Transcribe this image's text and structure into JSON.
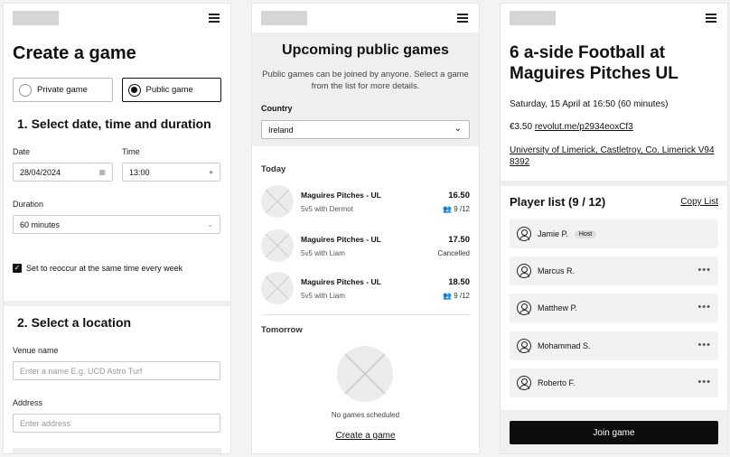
{
  "create": {
    "title": "Create a game",
    "private_label": "Private game",
    "public_label": "Public game",
    "step1": "1. Select date, time and duration",
    "date_label": "Date",
    "date_value": "28/04/2024",
    "time_label": "Time",
    "time_value": "13:00",
    "duration_label": "Duration",
    "duration_value": "60 minutes",
    "reoccur_label": "Set to reoccur at the same time every week",
    "step2": "2. Select a location",
    "venue_label": "Venue name",
    "venue_placeholder": "Enter a name E.g. UCD Astro Turf",
    "address_label": "Address",
    "address_placeholder": "Enter address"
  },
  "upcoming": {
    "title": "Upcoming public games",
    "description": "Public games can be joined by anyone. Select a game from the list for more details.",
    "country_label": "Country",
    "country_value": "Ireland",
    "today_label": "Today",
    "games": [
      {
        "name": "Maguires Pitches - UL",
        "sub": "5v5 with Dermot",
        "time": "16.50",
        "status": "9 /12"
      },
      {
        "name": "Maguires Pitches - UL",
        "sub": "5v5 with Liam",
        "time": "17.50",
        "status": "Cancelled"
      },
      {
        "name": "Maguires Pitches - UL",
        "sub": "5v5 with Liam",
        "time": "18.50",
        "status": "9 /12"
      }
    ],
    "tomorrow_label": "Tomorrow",
    "no_games": "No games scheduled",
    "create_link": "Create a game"
  },
  "detail": {
    "title": "6 a-side Football at Maguires Pitches UL",
    "datetime": "Saturday, 15 April at 16:50 (60 minutes)",
    "price": "€3.50",
    "pay_link": "revolut.me/p2934eoxCf3",
    "address": "University of Limerick, Castletroy, Co. Limerick V94 8392",
    "player_list": "Player list (9 / 12)",
    "copy_list": "Copy List",
    "players": [
      {
        "name": "Jamie P.",
        "badge": "Host"
      },
      {
        "name": "Marcus R.",
        "badge": ""
      },
      {
        "name": "Matthew P.",
        "badge": ""
      },
      {
        "name": "Mohammad S.",
        "badge": ""
      },
      {
        "name": "Roberto F.",
        "badge": ""
      }
    ],
    "join_label": "Join game"
  },
  "icons": {
    "menu": "hamburger-icon",
    "calendar": "calendar-icon",
    "clock": "clock-icon",
    "chevron": "chevron-down-icon",
    "people": "people-icon",
    "user": "user-icon",
    "more": "more-dots-icon"
  }
}
